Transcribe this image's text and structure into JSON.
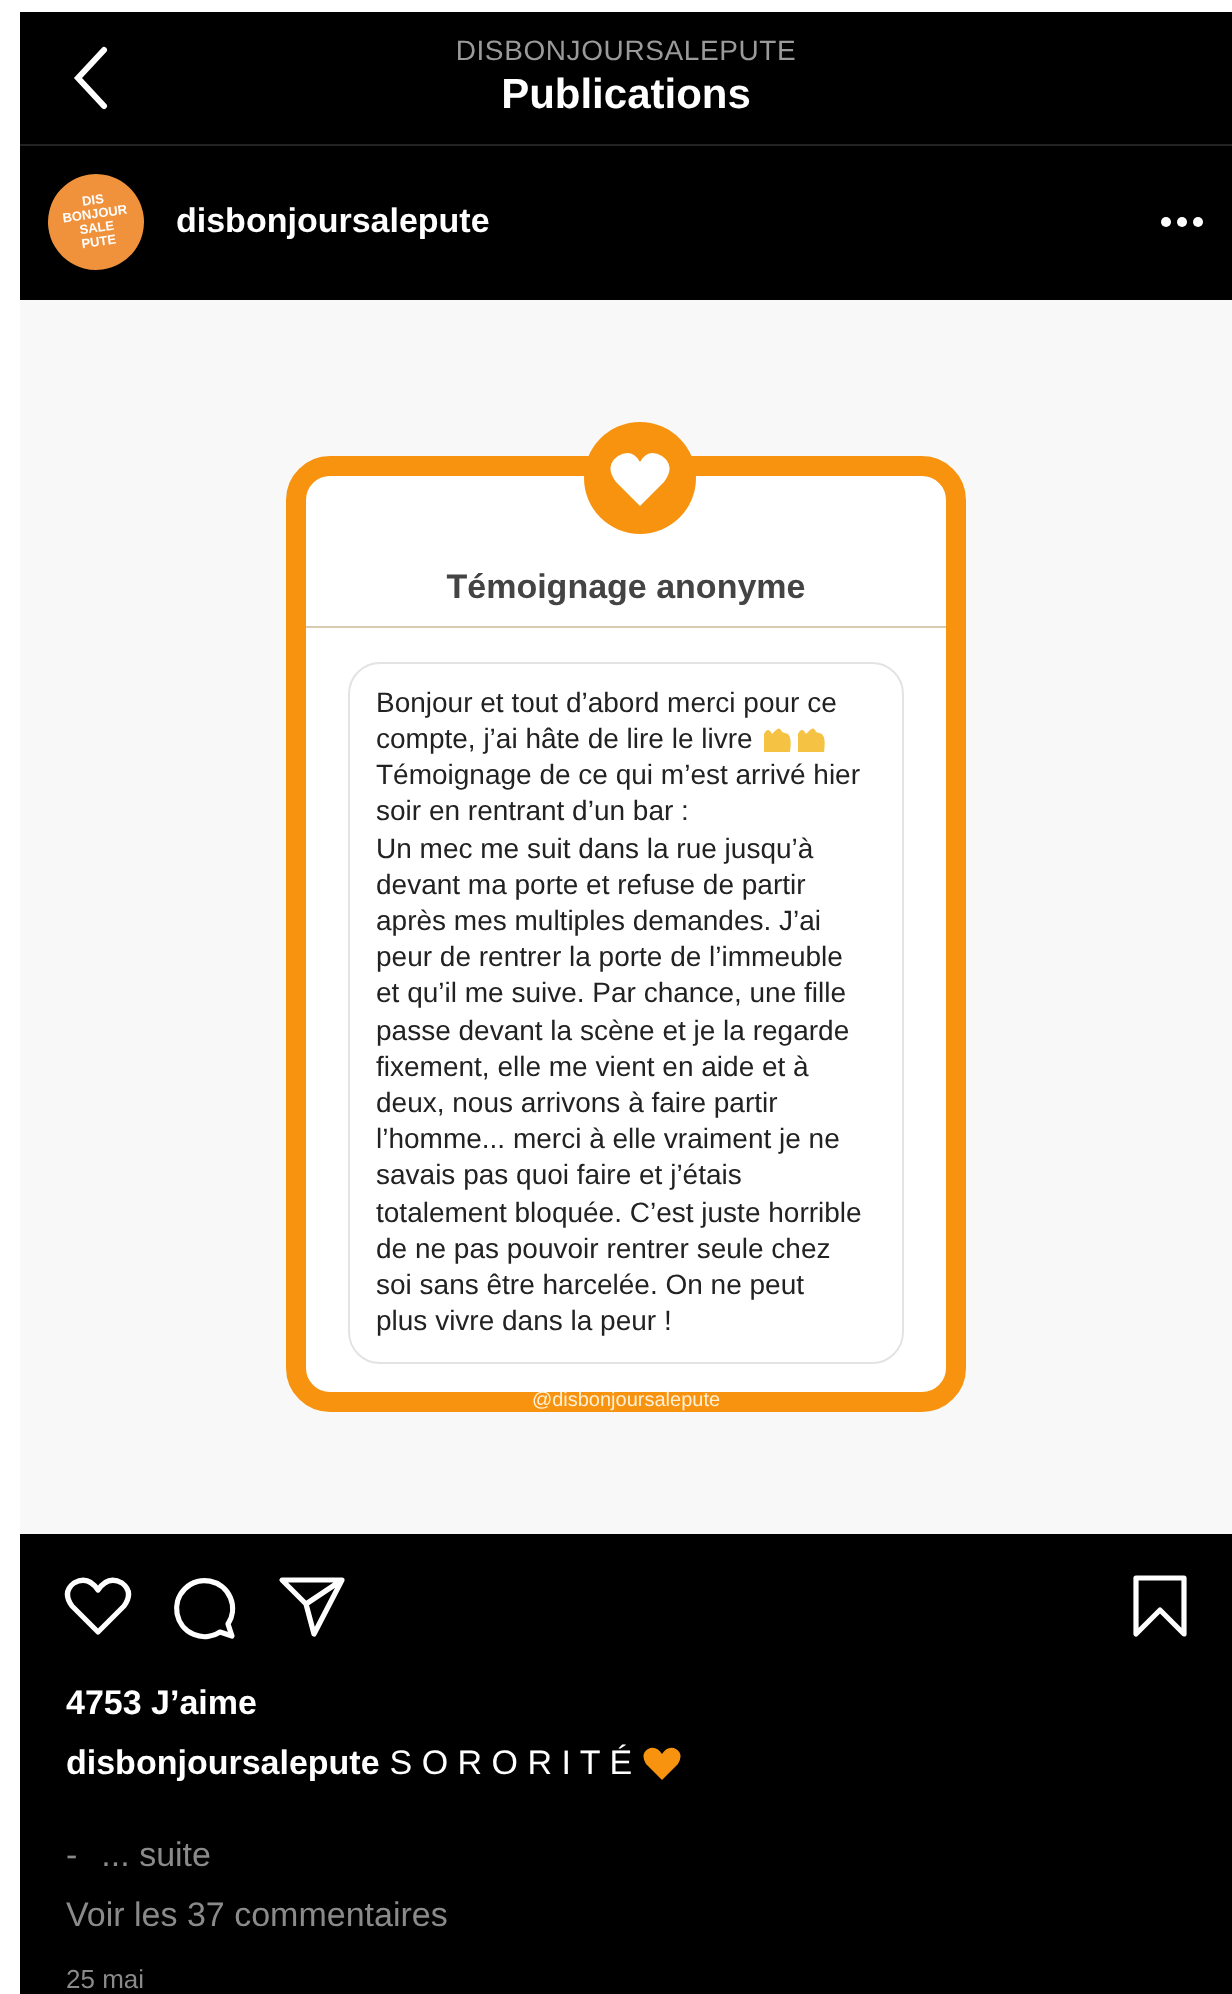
{
  "header": {
    "subtitle": "DISBONJOURSALEPUTE",
    "title": "Publications"
  },
  "author": {
    "avatar_lines": [
      "DIS",
      "BONJOUR",
      "SALE",
      "PUTE"
    ],
    "username": "disbonjoursalepute"
  },
  "post_card": {
    "title": "Témoignage anonyme",
    "paragraphs": [
      {
        "text": "Bonjour et tout d’abord merci pour ce compte, j’ai hâte de lire le livre",
        "emoji": true
      },
      {
        "text": "Témoignage de ce qui m’est arrivé hier soir en rentrant d’un bar :",
        "emoji": false
      },
      {
        "text": "Un mec me suit dans la rue jusqu’à devant ma porte et refuse de partir après mes multiples demandes. J’ai peur de rentrer la porte de l’immeuble et qu’il me suive. Par chance, une fille passe devant la scène et je la regarde fixement, elle me vient en aide et à deux, nous arrivons à faire partir l’homme... merci à elle vraiment je ne savais pas quoi faire et j’étais totalement bloquée. C’est juste horrible de ne pas pouvoir rentrer seule chez soi sans être harcelée. On ne peut plus vivre dans la peur !",
        "emoji": false
      }
    ],
    "handle": "@disbonjoursalepute"
  },
  "likes": "4753 J’aime",
  "caption": {
    "username": "disbonjoursalepute",
    "text": "S O R O R I T É"
  },
  "more": {
    "dash": "-",
    "link": "... suite"
  },
  "comments_link": "Voir les 37 commentaires",
  "date": "25 mai"
}
